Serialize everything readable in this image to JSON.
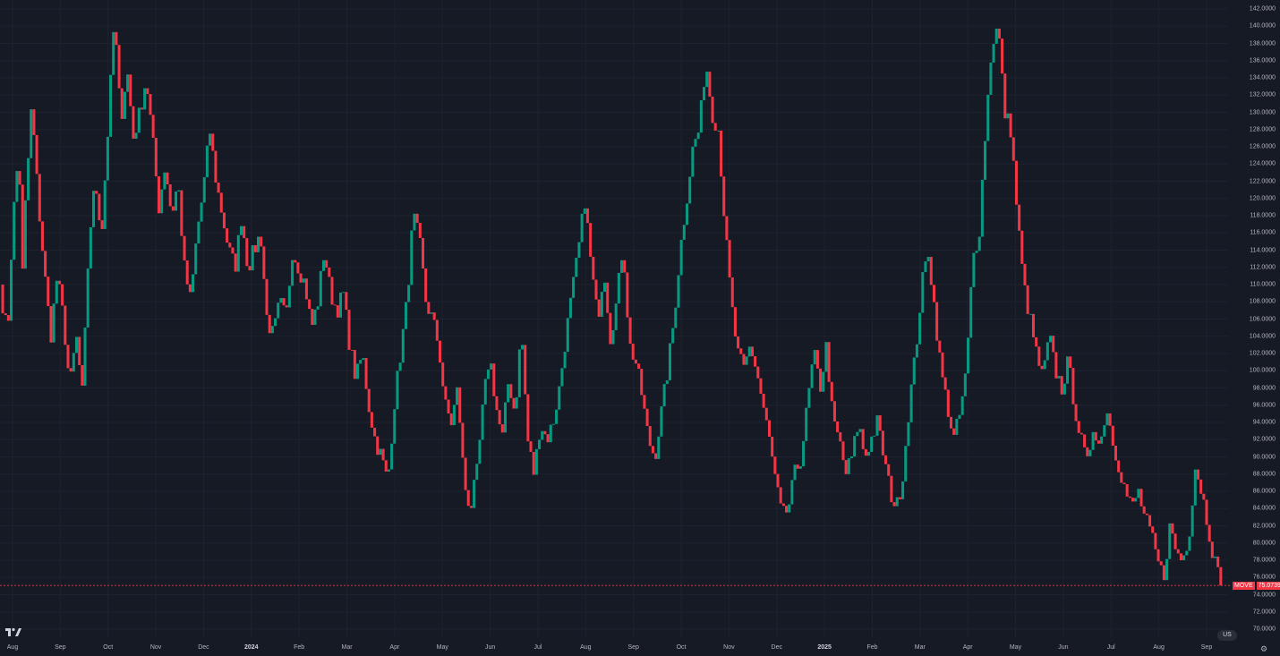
{
  "chart_data": {
    "type": "candlestick",
    "symbol": "MOVE",
    "last_price": "75.0739",
    "ylim": [
      70,
      142
    ],
    "y_ticks": [
      "142.0000",
      "140.0000",
      "138.0000",
      "136.0000",
      "134.0000",
      "132.0000",
      "130.0000",
      "128.0000",
      "126.0000",
      "124.0000",
      "122.0000",
      "120.0000",
      "118.0000",
      "116.0000",
      "114.0000",
      "112.0000",
      "110.0000",
      "108.0000",
      "106.0000",
      "104.0000",
      "102.0000",
      "100.0000",
      "98.0000",
      "96.0000",
      "94.0000",
      "92.0000",
      "90.0000",
      "88.0000",
      "86.0000",
      "84.0000",
      "82.0000",
      "80.0000",
      "78.0000",
      "76.0000",
      "74.0000",
      "72.0000",
      "70.0000"
    ],
    "x_ticks": [
      {
        "label": "Aug",
        "bold": false
      },
      {
        "label": "Sep",
        "bold": false
      },
      {
        "label": "Oct",
        "bold": false
      },
      {
        "label": "Nov",
        "bold": false
      },
      {
        "label": "Dec",
        "bold": false
      },
      {
        "label": "2024",
        "bold": true
      },
      {
        "label": "Feb",
        "bold": false
      },
      {
        "label": "Mar",
        "bold": false
      },
      {
        "label": "Apr",
        "bold": false
      },
      {
        "label": "May",
        "bold": false
      },
      {
        "label": "Jun",
        "bold": false
      },
      {
        "label": "Jul",
        "bold": false
      },
      {
        "label": "Aug",
        "bold": false
      },
      {
        "label": "Sep",
        "bold": false
      },
      {
        "label": "Oct",
        "bold": false
      },
      {
        "label": "Nov",
        "bold": false
      },
      {
        "label": "Dec",
        "bold": false
      },
      {
        "label": "2025",
        "bold": true
      },
      {
        "label": "Feb",
        "bold": false
      },
      {
        "label": "Mar",
        "bold": false
      },
      {
        "label": "Apr",
        "bold": false
      },
      {
        "label": "May",
        "bold": false
      },
      {
        "label": "Jun",
        "bold": false
      },
      {
        "label": "Jul",
        "bold": false
      },
      {
        "label": "Aug",
        "bold": false
      },
      {
        "label": "Sep",
        "bold": false
      }
    ],
    "path": [
      [
        0,
        110
      ],
      [
        1.2,
        104
      ],
      [
        2,
        117
      ],
      [
        3,
        126
      ],
      [
        3.5,
        110
      ],
      [
        4,
        119
      ],
      [
        5,
        131
      ],
      [
        6,
        120
      ],
      [
        7.2,
        110
      ],
      [
        8,
        104
      ],
      [
        9,
        111
      ],
      [
        10,
        106
      ],
      [
        11,
        98
      ],
      [
        12,
        104
      ],
      [
        13,
        97
      ],
      [
        14,
        115
      ],
      [
        15,
        122
      ],
      [
        16,
        116
      ],
      [
        17,
        128
      ],
      [
        18,
        141
      ],
      [
        19,
        129
      ],
      [
        20,
        135
      ],
      [
        21,
        127
      ],
      [
        22,
        130
      ],
      [
        23,
        134
      ],
      [
        24,
        127
      ],
      [
        25,
        119
      ],
      [
        26,
        124
      ],
      [
        27,
        118
      ],
      [
        28,
        122
      ],
      [
        29,
        112
      ],
      [
        30,
        108
      ],
      [
        31,
        116
      ],
      [
        32,
        121
      ],
      [
        33,
        128
      ],
      [
        34,
        122
      ],
      [
        35,
        118
      ],
      [
        36,
        114
      ],
      [
        37,
        112
      ],
      [
        38,
        118
      ],
      [
        39,
        112
      ],
      [
        40,
        114
      ],
      [
        41,
        116
      ],
      [
        42,
        106
      ],
      [
        43,
        104
      ],
      [
        44,
        108
      ],
      [
        45,
        106
      ],
      [
        46,
        114
      ],
      [
        47,
        112
      ],
      [
        48,
        110
      ],
      [
        49,
        105
      ],
      [
        50,
        108
      ],
      [
        51,
        114
      ],
      [
        52,
        109
      ],
      [
        53,
        107
      ],
      [
        54,
        109
      ],
      [
        55,
        103
      ],
      [
        56,
        99
      ],
      [
        57,
        102
      ],
      [
        58,
        96
      ],
      [
        59,
        92
      ],
      [
        60,
        90
      ],
      [
        61,
        87
      ],
      [
        62,
        96
      ],
      [
        63,
        102
      ],
      [
        64,
        108
      ],
      [
        65,
        118
      ],
      [
        66,
        115
      ],
      [
        67,
        108
      ],
      [
        68,
        106
      ],
      [
        69,
        103
      ],
      [
        70,
        96
      ],
      [
        71,
        94
      ],
      [
        72,
        98
      ],
      [
        73,
        87
      ],
      [
        74,
        84
      ],
      [
        75,
        88
      ],
      [
        76,
        96
      ],
      [
        77,
        102
      ],
      [
        78,
        96
      ],
      [
        79,
        92
      ],
      [
        80,
        99
      ],
      [
        81,
        95
      ],
      [
        82,
        105
      ],
      [
        83,
        92
      ],
      [
        84,
        88
      ],
      [
        85,
        94
      ],
      [
        86,
        92
      ],
      [
        87,
        94
      ],
      [
        88,
        98
      ],
      [
        89,
        104
      ],
      [
        90,
        109
      ],
      [
        91,
        114
      ],
      [
        92,
        120
      ],
      [
        93,
        112
      ],
      [
        94,
        106
      ],
      [
        95,
        112
      ],
      [
        96,
        104
      ],
      [
        97,
        108
      ],
      [
        98,
        115
      ],
      [
        99,
        103
      ],
      [
        100,
        101
      ],
      [
        101,
        97
      ],
      [
        102,
        92
      ],
      [
        103,
        90
      ],
      [
        104,
        95
      ],
      [
        105,
        100
      ],
      [
        106,
        106
      ],
      [
        107,
        114
      ],
      [
        108,
        120
      ],
      [
        109,
        126
      ],
      [
        110,
        128
      ],
      [
        111,
        136
      ],
      [
        112,
        130
      ],
      [
        113,
        128
      ],
      [
        114,
        117
      ],
      [
        115,
        108
      ],
      [
        116,
        102
      ],
      [
        117,
        100
      ],
      [
        118,
        103
      ],
      [
        119,
        100
      ],
      [
        120,
        96
      ],
      [
        121,
        92
      ],
      [
        122,
        87
      ],
      [
        123,
        83
      ],
      [
        124,
        84
      ],
      [
        125,
        88
      ],
      [
        126,
        90
      ],
      [
        127,
        96
      ],
      [
        128,
        102
      ],
      [
        129,
        98
      ],
      [
        130,
        103
      ],
      [
        131,
        94
      ],
      [
        132,
        92
      ],
      [
        133,
        88
      ],
      [
        134,
        90
      ],
      [
        135,
        94
      ],
      [
        136,
        90
      ],
      [
        137,
        92
      ],
      [
        138,
        94
      ],
      [
        139,
        90
      ],
      [
        140,
        86
      ],
      [
        141,
        84
      ],
      [
        142,
        88
      ],
      [
        143,
        96
      ],
      [
        144,
        102
      ],
      [
        145,
        110
      ],
      [
        146,
        114
      ],
      [
        147,
        107
      ],
      [
        148,
        100
      ],
      [
        149,
        96
      ],
      [
        150,
        92
      ],
      [
        151,
        95
      ],
      [
        152,
        100
      ],
      [
        153,
        113
      ],
      [
        154,
        116
      ],
      [
        155,
        128
      ],
      [
        156,
        138
      ],
      [
        157,
        140
      ],
      [
        158,
        130
      ],
      [
        159,
        128
      ],
      [
        160,
        118
      ],
      [
        161,
        110
      ],
      [
        162,
        106
      ],
      [
        163,
        102
      ],
      [
        164,
        99
      ],
      [
        165,
        104
      ],
      [
        166,
        100
      ],
      [
        167,
        98
      ],
      [
        168,
        101
      ],
      [
        169,
        96
      ],
      [
        170,
        92
      ],
      [
        171,
        89
      ],
      [
        172,
        94
      ],
      [
        173,
        91
      ],
      [
        174,
        96
      ],
      [
        175,
        92
      ],
      [
        176,
        89
      ],
      [
        177,
        86
      ],
      [
        178,
        84
      ],
      [
        179,
        86
      ],
      [
        180,
        83
      ],
      [
        181,
        81
      ],
      [
        182,
        78
      ],
      [
        183,
        76
      ],
      [
        184,
        82
      ],
      [
        185,
        79
      ],
      [
        186,
        78
      ],
      [
        187,
        81
      ],
      [
        188,
        89
      ],
      [
        189,
        86
      ],
      [
        190,
        82
      ],
      [
        191,
        78
      ],
      [
        192,
        75.0739
      ]
    ]
  },
  "ui": {
    "symbol_label": "MOVE",
    "price_label": "75.0739",
    "flags_label": "US"
  }
}
